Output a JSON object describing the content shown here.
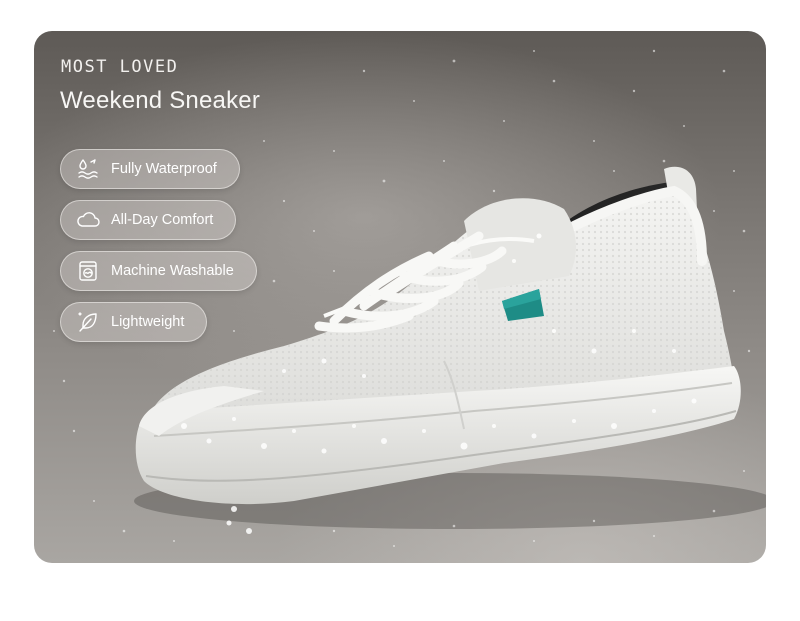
{
  "hero": {
    "eyebrow": "MOST LOVED",
    "title": "Weekend Sneaker"
  },
  "features": [
    {
      "label": "Fully Waterproof",
      "icon": "water-drop-icon"
    },
    {
      "label": "All-Day Comfort",
      "icon": "cloud-icon"
    },
    {
      "label": "Machine Washable",
      "icon": "washing-machine-icon"
    },
    {
      "label": "Lightweight",
      "icon": "feather-icon"
    }
  ],
  "colors": {
    "text": "#ffffff",
    "shoe": "#eeeeec",
    "accent_tab": "#1e8c86"
  }
}
